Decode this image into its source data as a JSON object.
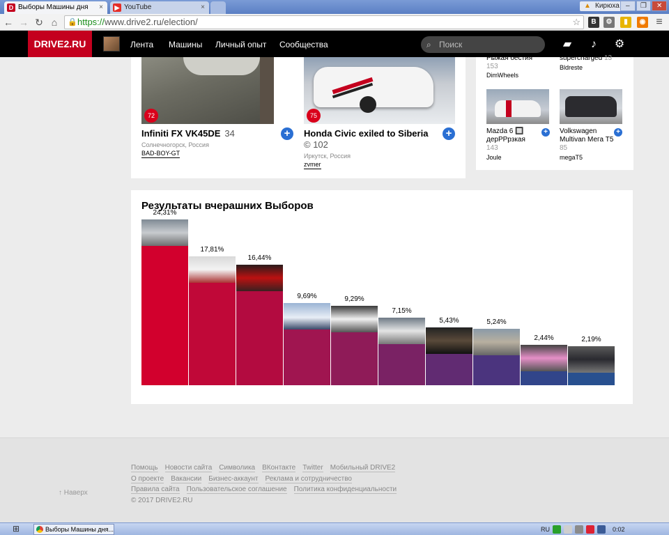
{
  "browser": {
    "tabs": [
      {
        "label": "Выборы Машины дня",
        "close": "×"
      },
      {
        "label": "YouTube",
        "close": "×"
      }
    ],
    "window_user": "Кирюха",
    "window_controls": {
      "minimize": "–",
      "restore": "❐",
      "close": "✕"
    },
    "url_scheme": "https://",
    "url_rest": "www.drive2.ru/election/"
  },
  "header": {
    "logo": "DRIVE2.RU",
    "nav": [
      "Лента",
      "Машины",
      "Личный опыт",
      "Сообщества"
    ],
    "search_placeholder": "Поиск"
  },
  "main_cards": [
    {
      "badge": "72",
      "title": "Infiniti FX VK45DE",
      "count": "34",
      "city": "Солнечногорск, Россия",
      "user": "BAD-BOY-GT"
    },
    {
      "badge": "75",
      "title": "Honda Civic exiled to Siberia",
      "count_line": "© 102",
      "city": "Иркутск, Россия",
      "user": "zvmer"
    }
  ],
  "side_cards": [
    {
      "title_partial": "Рыжая бестия",
      "count": "153",
      "user": "DimWheels"
    },
    {
      "title_partial": "supercharged",
      "count": "13",
      "user": "Bldreste"
    },
    {
      "title": "Mazda 6 🔲 дерРРрзкая",
      "count": "143",
      "user": "Joule"
    },
    {
      "title": "Volkswagen Multivan Мега T5",
      "count": "85",
      "user": "megaT5"
    }
  ],
  "results": {
    "title": "Результаты вчерашних Выборов"
  },
  "chart_data": {
    "type": "bar",
    "title": "Результаты вчерашних Выборов",
    "value_labels": [
      "24,31%",
      "17,81%",
      "16,44%",
      "9,69%",
      "9,29%",
      "7,15%",
      "5,43%",
      "5,24%",
      "2,44%",
      "2,19%"
    ],
    "values": [
      24.31,
      17.81,
      16.44,
      9.69,
      9.29,
      7.15,
      5.43,
      5.24,
      2.44,
      2.19
    ],
    "unit": "%",
    "colors": [
      "#d2002d",
      "#c00838",
      "#b30b40",
      "#a01550",
      "#8f1b58",
      "#7a2264",
      "#612b72",
      "#4b347e",
      "#31458a",
      "#28508f"
    ],
    "ylim": [
      0,
      24.31
    ],
    "grid": false,
    "legend": "none"
  },
  "footer": {
    "top_link": "Наверх",
    "row1": [
      "Помощь",
      "Новости сайта",
      "Символика",
      "ВКонтакте",
      "Twitter",
      "Мобильный DRIVE2"
    ],
    "row2": [
      "О проекте",
      "Вакансии",
      "Бизнес-аккаунт",
      "Реклама и сотрудничество"
    ],
    "row3": [
      "Правила сайта",
      "Пользовательское соглашение",
      "Политика конфиденциальности"
    ],
    "copyright": "© 2017 DRIVE2.RU"
  },
  "taskbar": {
    "task_label": "Выборы Машины дня...",
    "lang": "RU",
    "clock": "0:02"
  }
}
